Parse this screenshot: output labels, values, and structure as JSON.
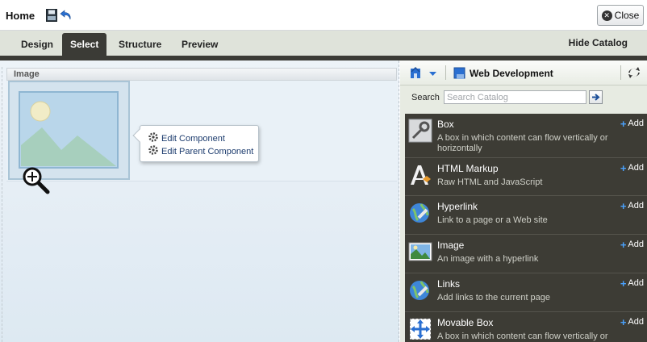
{
  "topbar": {
    "title": "Home",
    "close_label": "Close"
  },
  "tabs": [
    {
      "label": "Design",
      "active": false
    },
    {
      "label": "Select",
      "active": true
    },
    {
      "label": "Structure",
      "active": false
    },
    {
      "label": "Preview",
      "active": false
    }
  ],
  "hide_catalog_label": "Hide Catalog",
  "canvas": {
    "component_header": "Image",
    "popup_items": [
      "Edit Component",
      "Edit Parent Component"
    ]
  },
  "catalog": {
    "folder_label": "Web Development",
    "search_label": "Search",
    "search_placeholder": "Search Catalog",
    "add_label": "Add",
    "items": [
      {
        "name": "Box",
        "desc": "A box in which content can flow vertically or horizontally",
        "icon": "box-icon"
      },
      {
        "name": "HTML Markup",
        "desc": "Raw HTML and JavaScript",
        "icon": "html-markup-icon"
      },
      {
        "name": "Hyperlink",
        "desc": "Link to a page or a Web site",
        "icon": "hyperlink-icon"
      },
      {
        "name": "Image",
        "desc": "An image with a hyperlink",
        "icon": "image-icon"
      },
      {
        "name": "Links",
        "desc": "Add links to the current page",
        "icon": "links-icon"
      },
      {
        "name": "Movable Box",
        "desc": "A box in which content can flow vertically or",
        "icon": "movable-box-icon"
      }
    ]
  },
  "colors": {
    "tab_active_bg": "#3b3b36",
    "catalog_list_bg": "#3d3c35",
    "add_plus": "#4aa3ff",
    "link_text": "#1d3c6e"
  }
}
